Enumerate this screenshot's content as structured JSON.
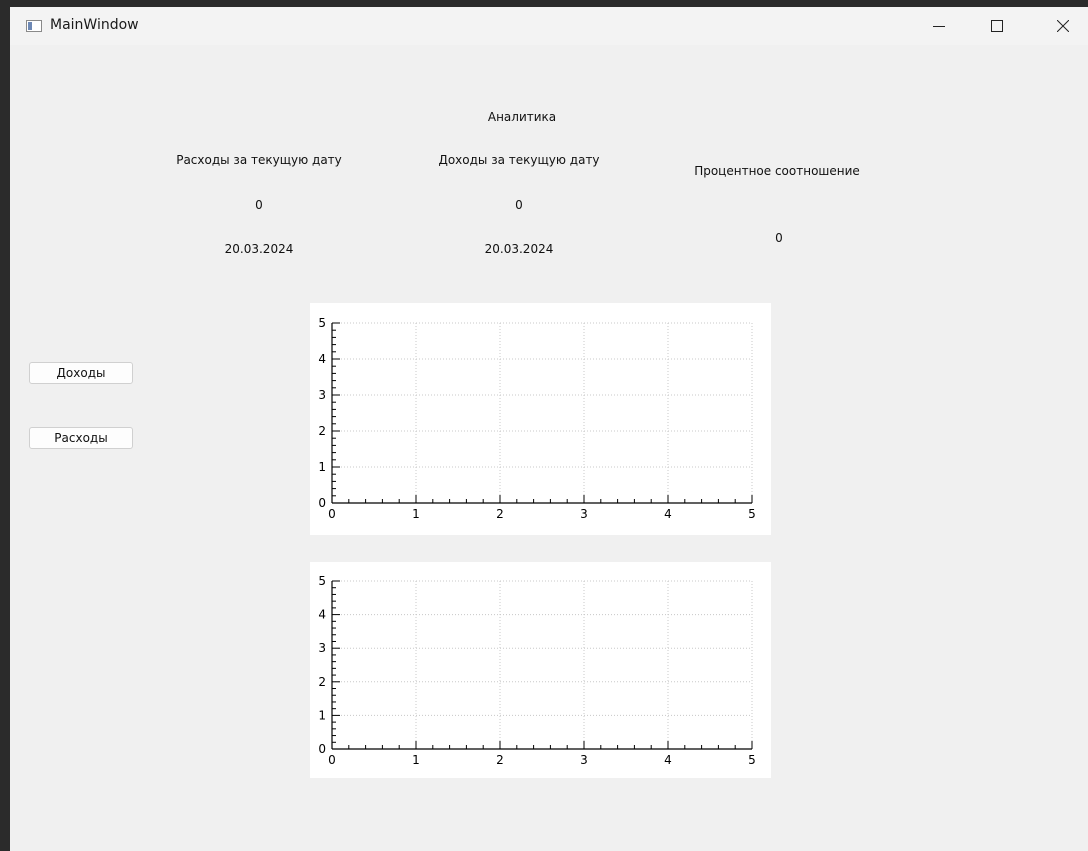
{
  "window": {
    "title": "MainWindow"
  },
  "analytics": {
    "heading": "Аналитика",
    "expenses": {
      "label": "Расходы за текущую дату",
      "value": "0",
      "date": "20.03.2024"
    },
    "income": {
      "label": "Доходы за текущую дату",
      "value": "0",
      "date": "20.03.2024"
    },
    "ratio": {
      "label": "Процентное соотношение",
      "value": "0"
    }
  },
  "buttons": {
    "income": "Доходы",
    "expenses": "Расходы"
  },
  "chart_data": [
    {
      "type": "line",
      "series": [],
      "xlim": [
        0,
        5
      ],
      "ylim": [
        0,
        5
      ],
      "xticks": [
        "0",
        "1",
        "2",
        "3",
        "4",
        "5"
      ],
      "yticks": [
        "0",
        "1",
        "2",
        "3",
        "4",
        "5"
      ],
      "grid": true,
      "grid_style": "dotted"
    },
    {
      "type": "line",
      "series": [],
      "xlim": [
        0,
        5
      ],
      "ylim": [
        0,
        5
      ],
      "xticks": [
        "0",
        "1",
        "2",
        "3",
        "4",
        "5"
      ],
      "yticks": [
        "0",
        "1",
        "2",
        "3",
        "4",
        "5"
      ],
      "grid": true,
      "grid_style": "dotted"
    }
  ]
}
